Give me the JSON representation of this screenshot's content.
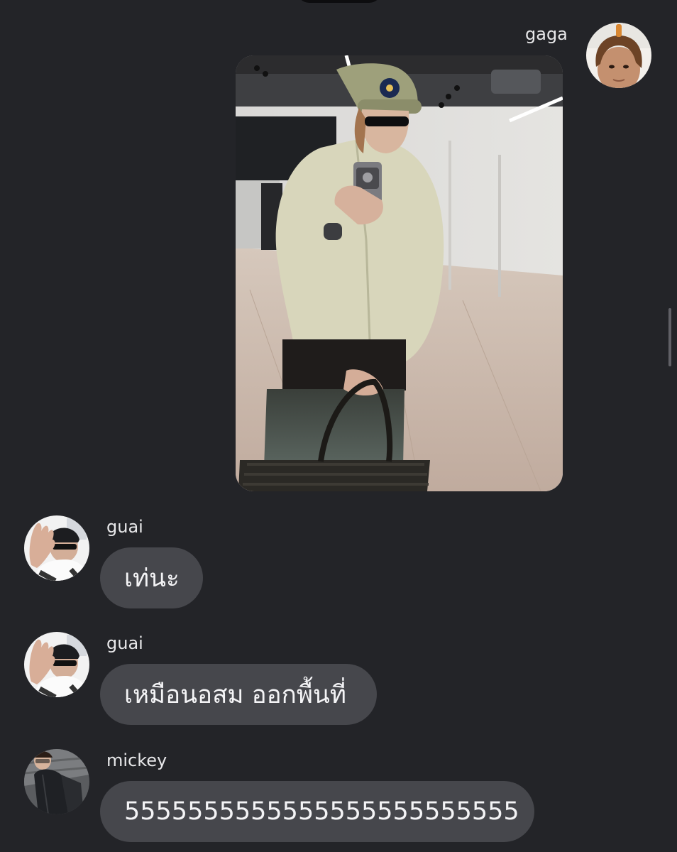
{
  "conversation": {
    "messages": [
      {
        "sender": "gaga",
        "direction": "outgoing",
        "type": "image",
        "image_icon": "mirror-selfie-photo"
      },
      {
        "sender": "guai",
        "direction": "incoming",
        "type": "text",
        "text": "เท่นะ"
      },
      {
        "sender": "guai",
        "direction": "incoming",
        "type": "text",
        "text": "เหมือนอสม ออกพื้นที่"
      },
      {
        "sender": "mickey",
        "direction": "incoming",
        "type": "text",
        "text": "5555555555555555555555555"
      }
    ]
  },
  "theme": {
    "background": "#232428",
    "bubble": "#46474c",
    "text": "#f4f4f6"
  }
}
